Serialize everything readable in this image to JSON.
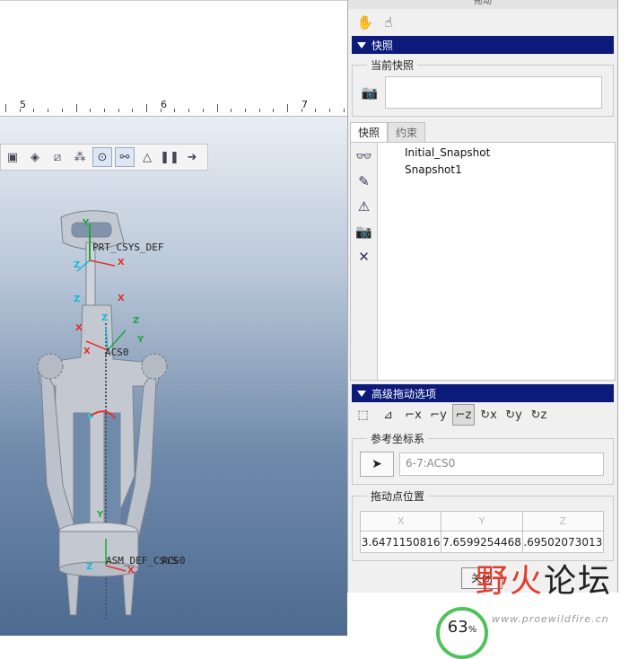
{
  "ruler": {
    "labels": [
      "5",
      "6",
      "7"
    ]
  },
  "model": {
    "labels": [
      "PRT_CSYS_DEF",
      "ACS0",
      "ASM_DEF_CSYS",
      "ACS0"
    ],
    "axes": [
      "Y",
      "X",
      "Z",
      "Z",
      "X",
      "Y",
      "Z",
      "X",
      "Z",
      "X",
      "Y",
      "Z",
      "X"
    ]
  },
  "view_toolbar": {
    "icons": [
      "saved-view-icon",
      "appearance-icon",
      "datum-plane-icon",
      "csys-display-icon",
      "spin-center-icon",
      "annotation-icon",
      "orientation-icon",
      "pause-icon",
      "next-icon"
    ]
  },
  "panel": {
    "title": "拖动",
    "snapshots_section": "快照",
    "current_snapshot_label": "当前快照",
    "current_snapshot_value": "",
    "tabs": [
      "快照",
      "约束"
    ],
    "snapshots": [
      "Initial_Snapshot",
      "Snapshot1"
    ],
    "advanced_section": "高级拖动选项",
    "reference_csys_label": "参考坐标系",
    "reference_csys_value": "6-7:ACS0",
    "drag_point_label": "拖动点位置",
    "columns": [
      "X",
      "Y",
      "Z"
    ],
    "values": [
      "3.6471150816",
      "7.6599254468",
      ".69502073013"
    ],
    "close": "关闭"
  },
  "watermark": {
    "logo_1": "野",
    "logo_2": "火",
    "logo_3": "论坛",
    "url": "www.proewildfire.cn"
  },
  "progress": {
    "value": "63",
    "unit": "%"
  },
  "colors": {
    "section_header": "#0c1a7a",
    "progress_ring": "#4ec35a",
    "watermark_red": "#e23a2a"
  }
}
